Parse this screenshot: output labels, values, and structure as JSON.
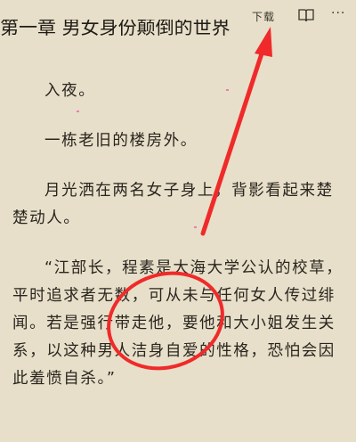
{
  "toolbar": {
    "download_label": "下载",
    "book_icon": "book-icon",
    "more_icon": "more-icon",
    "more_glyph": "···"
  },
  "chapter": {
    "title": "第一章 男女身份颠倒的世界"
  },
  "paragraphs": [
    "入夜。",
    "一栋老旧的楼房外。",
    "月光洒在两名女子身上，背影看起来楚楚动人。",
    "“江部长，程素是大海大学公认的校草，平时追求者无数，可从未与任何女人传过绯闻。若是强行带走他，要他和大小姐发生关系，以这种男人洁身自爱的性格，恐怕会因此羞愤自杀。”"
  ],
  "annotation": {
    "color": "#f02a2a",
    "shapes": [
      "red-circle",
      "red-arrow"
    ]
  }
}
